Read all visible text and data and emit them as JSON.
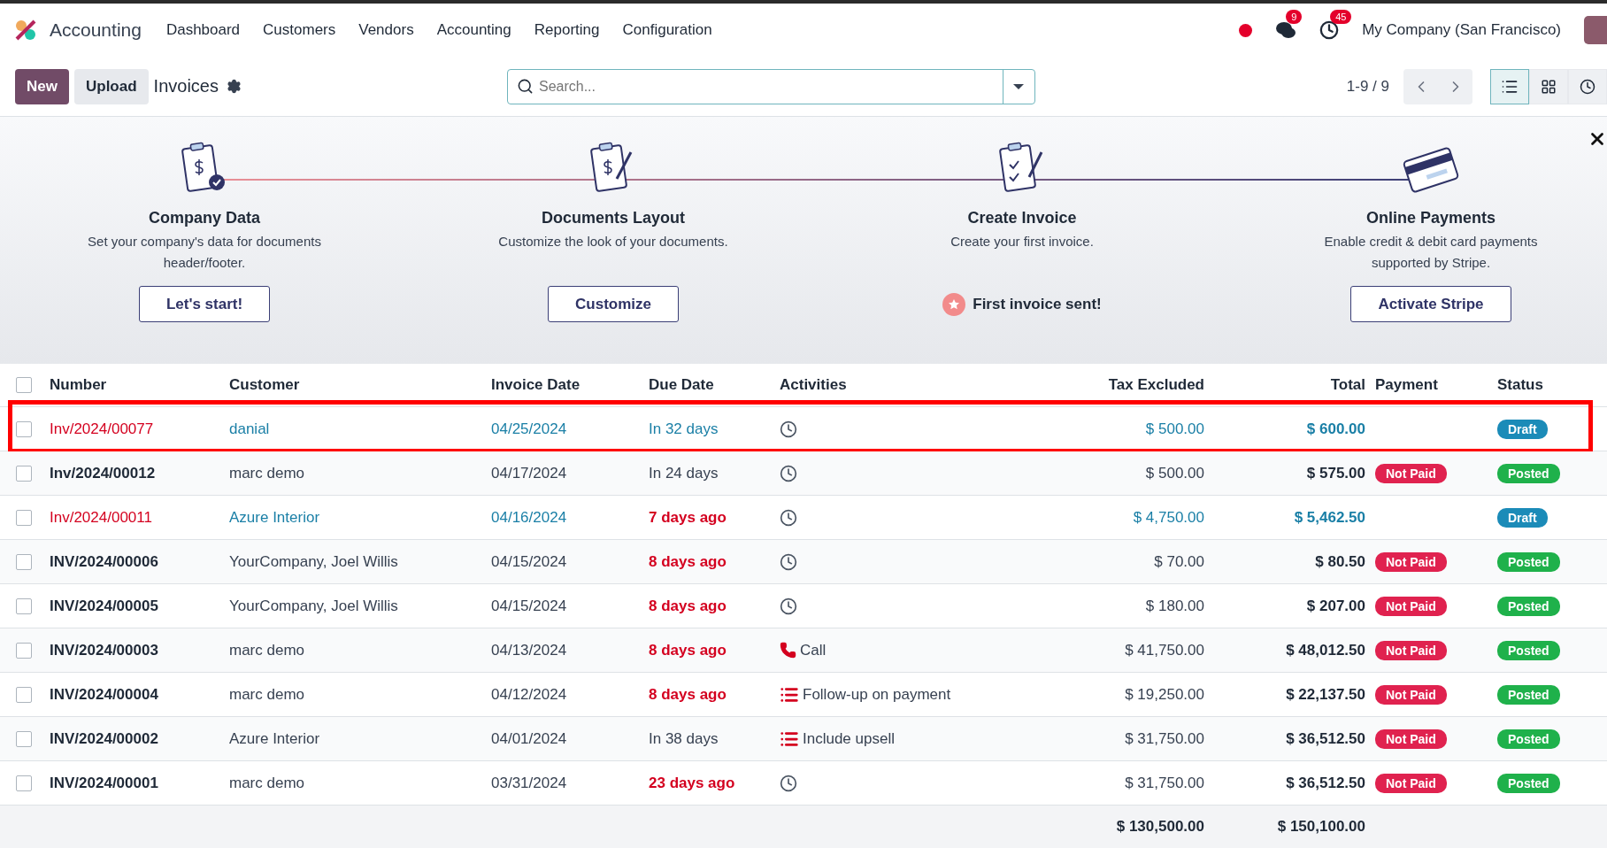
{
  "navbar": {
    "app_name": "Accounting",
    "menu": [
      "Dashboard",
      "Customers",
      "Vendors",
      "Accounting",
      "Reporting",
      "Configuration"
    ],
    "messages_count": "9",
    "activities_count": "45",
    "company": "My Company (San Francisco)"
  },
  "control_panel": {
    "buttons": [
      {
        "label": "New",
        "kind": "primary"
      },
      {
        "label": "Upload",
        "kind": "secondary"
      }
    ],
    "title": "Invoices",
    "search": {
      "placeholder": "Search..."
    },
    "pager": "1-9 / 9",
    "views": [
      {
        "kind": "list",
        "selected": true
      },
      {
        "kind": "kanban",
        "selected": false
      },
      {
        "kind": "activity",
        "selected": false
      }
    ]
  },
  "onboarding": {
    "steps": [
      {
        "kind": "company",
        "title": "Company Data",
        "description": "Set your company's data for documents header/footer.",
        "action": "Let's start!",
        "done": false
      },
      {
        "kind": "layout",
        "title": "Documents Layout",
        "description": "Customize the look of your documents.",
        "action": "Customize",
        "done": false
      },
      {
        "kind": "invoice",
        "title": "Create Invoice",
        "description": "Create your first invoice.",
        "action": "First invoice sent!",
        "done": true
      },
      {
        "kind": "payment",
        "title": "Online Payments",
        "description": "Enable credit & debit card payments supported by Stripe.",
        "action": "Activate Stripe",
        "done": false
      }
    ]
  },
  "table": {
    "all_selected": false,
    "columns": [
      "Number",
      "Customer",
      "Invoice Date",
      "Due Date",
      "Activities",
      "Tax Excluded",
      "Total",
      "Payment",
      "Status"
    ],
    "rows": [
      {
        "selected": false,
        "highlighted": true,
        "kind": "draft",
        "number": "Inv/2024/00077",
        "customer": "danial",
        "invoice_date": "04/25/2024",
        "due_date": "In 32 days",
        "overdue": false,
        "activity": {
          "kind": "clock"
        },
        "tax_excluded": "$ 500.00",
        "total": "$ 600.00",
        "status": {
          "label": "Draft",
          "kind": "draft"
        }
      },
      {
        "selected": false,
        "highlighted": false,
        "kind": "posted",
        "number": "Inv/2024/00012",
        "customer": "marc demo",
        "invoice_date": "04/17/2024",
        "due_date": "In 24 days",
        "overdue": false,
        "activity": {
          "kind": "clock"
        },
        "tax_excluded": "$ 500.00",
        "total": "$ 575.00",
        "payment": {
          "label": "Not Paid",
          "kind": "not_paid"
        },
        "status": {
          "label": "Posted",
          "kind": "posted"
        }
      },
      {
        "selected": false,
        "highlighted": false,
        "kind": "draft",
        "number": "Inv/2024/00011",
        "customer": "Azure Interior",
        "invoice_date": "04/16/2024",
        "due_date": "7 days ago",
        "overdue": true,
        "activity": {
          "kind": "clock"
        },
        "tax_excluded": "$ 4,750.00",
        "total": "$ 5,462.50",
        "status": {
          "label": "Draft",
          "kind": "draft"
        }
      },
      {
        "selected": false,
        "highlighted": false,
        "kind": "posted",
        "number": "INV/2024/00006",
        "customer": "YourCompany, Joel Willis",
        "invoice_date": "04/15/2024",
        "due_date": "8 days ago",
        "overdue": true,
        "activity": {
          "kind": "clock"
        },
        "tax_excluded": "$ 70.00",
        "total": "$ 80.50",
        "payment": {
          "label": "Not Paid",
          "kind": "not_paid"
        },
        "status": {
          "label": "Posted",
          "kind": "posted"
        }
      },
      {
        "selected": false,
        "highlighted": false,
        "kind": "posted",
        "number": "INV/2024/00005",
        "customer": "YourCompany, Joel Willis",
        "invoice_date": "04/15/2024",
        "due_date": "8 days ago",
        "overdue": true,
        "activity": {
          "kind": "clock"
        },
        "tax_excluded": "$ 180.00",
        "total": "$ 207.00",
        "payment": {
          "label": "Not Paid",
          "kind": "not_paid"
        },
        "status": {
          "label": "Posted",
          "kind": "posted"
        }
      },
      {
        "selected": false,
        "highlighted": false,
        "kind": "posted",
        "number": "INV/2024/00003",
        "customer": "marc demo",
        "invoice_date": "04/13/2024",
        "due_date": "8 days ago",
        "overdue": true,
        "activity": {
          "kind": "phone",
          "label": "Call"
        },
        "tax_excluded": "$ 41,750.00",
        "total": "$ 48,012.50",
        "payment": {
          "label": "Not Paid",
          "kind": "not_paid"
        },
        "status": {
          "label": "Posted",
          "kind": "posted"
        }
      },
      {
        "selected": false,
        "highlighted": false,
        "kind": "posted",
        "number": "INV/2024/00004",
        "customer": "marc demo",
        "invoice_date": "04/12/2024",
        "due_date": "8 days ago",
        "overdue": true,
        "activity": {
          "kind": "todo",
          "label": "Follow-up on payment"
        },
        "tax_excluded": "$ 19,250.00",
        "total": "$ 22,137.50",
        "payment": {
          "label": "Not Paid",
          "kind": "not_paid"
        },
        "status": {
          "label": "Posted",
          "kind": "posted"
        }
      },
      {
        "selected": false,
        "highlighted": false,
        "kind": "posted",
        "number": "INV/2024/00002",
        "customer": "Azure Interior",
        "invoice_date": "04/01/2024",
        "due_date": "In 38 days",
        "overdue": false,
        "activity": {
          "kind": "todo",
          "label": "Include upsell"
        },
        "tax_excluded": "$ 31,750.00",
        "total": "$ 36,512.50",
        "payment": {
          "label": "Not Paid",
          "kind": "not_paid"
        },
        "status": {
          "label": "Posted",
          "kind": "posted"
        }
      },
      {
        "selected": false,
        "highlighted": false,
        "kind": "posted",
        "number": "INV/2024/00001",
        "customer": "marc demo",
        "invoice_date": "03/31/2024",
        "due_date": "23 days ago",
        "overdue": true,
        "activity": {
          "kind": "clock"
        },
        "tax_excluded": "$ 31,750.00",
        "total": "$ 36,512.50",
        "payment": {
          "label": "Not Paid",
          "kind": "not_paid"
        },
        "status": {
          "label": "Posted",
          "kind": "posted"
        }
      }
    ],
    "totals": {
      "tax_excluded": "$ 130,500.00",
      "total": "$ 150,100.00"
    }
  }
}
